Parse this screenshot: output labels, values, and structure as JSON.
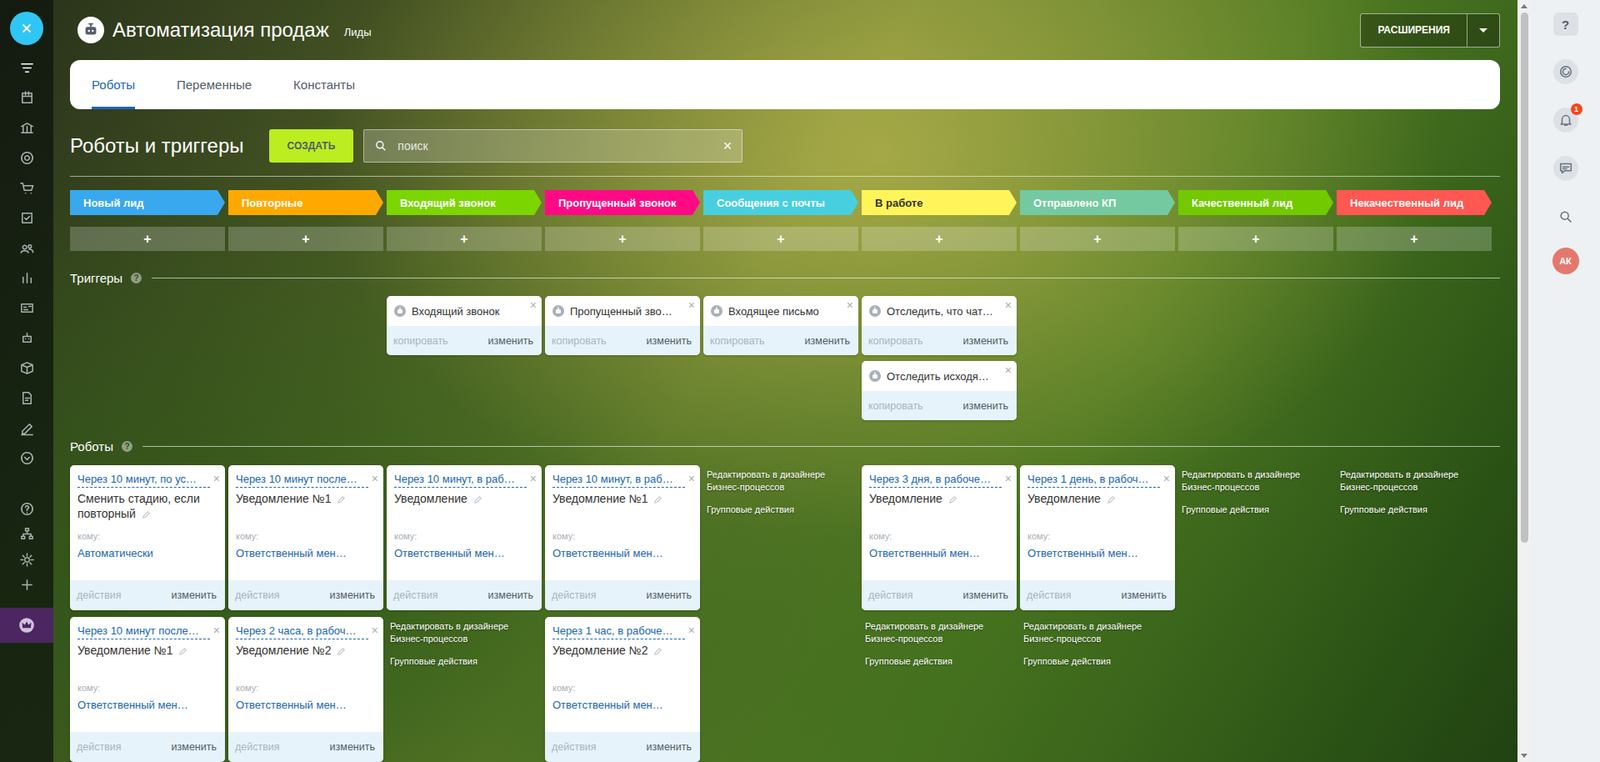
{
  "app": {
    "title": "Автоматизация продаж",
    "subtitle": "Лиды",
    "extensions_button": "РАСШИРЕНИЯ"
  },
  "tabs": [
    {
      "label": "Роботы",
      "selected": true
    },
    {
      "label": "Переменные",
      "selected": false
    },
    {
      "label": "Константы",
      "selected": false
    }
  ],
  "toolbar": {
    "heading": "Роботы и триггеры",
    "create_button": "СОЗДАТЬ",
    "search": {
      "placeholder": "поиск",
      "clear": "×"
    }
  },
  "add_symbol": "+",
  "sections": {
    "triggers": {
      "title": "Триггеры",
      "help": "?"
    },
    "robots": {
      "title": "Роботы",
      "help": "?"
    }
  },
  "labels": {
    "close": "×",
    "copy": {
      "text": "копировать",
      "disabled": true
    },
    "edit": {
      "text": "изменить",
      "disabled": false
    },
    "actions": {
      "text": "действия",
      "disabled": true
    },
    "recipient": "кому:"
  },
  "stages": [
    {
      "name": "Новый лид",
      "color": "#39a8ef",
      "triggers": [],
      "robots": [
        {
          "delay": "Через 10 минут, по ус…",
          "title": "Сменить стадию, если повторный",
          "recipient": "Автоматически"
        },
        {
          "delay": "Через 10 минут после…",
          "title": "Уведомление №1",
          "recipient": "Ответственный мен…"
        }
      ],
      "links": []
    },
    {
      "name": "Повторные",
      "color": "#ffa900",
      "triggers": [],
      "robots": [
        {
          "delay": "Через 10 минут после…",
          "title": "Уведомление №1",
          "recipient": "Ответственный мен…"
        },
        {
          "delay": "Через 2 часа, в рабоч…",
          "title": "Уведомление №2",
          "recipient": "Ответственный мен…"
        }
      ],
      "links": []
    },
    {
      "name": "Входящий звонок",
      "color": "#7bd500",
      "triggers": [
        "Входящий звонок"
      ],
      "robots": [
        {
          "delay": "Через 10 минут, в раб…",
          "title": "Уведомление",
          "recipient": "Ответственный мен…"
        }
      ],
      "links": [
        "Редактировать в дизайнере Бизнес-процессов",
        "Групповые действия"
      ]
    },
    {
      "name": "Пропущенный звонок",
      "color": "#ff0a84",
      "triggers": [
        "Пропущенный зво…"
      ],
      "robots": [
        {
          "delay": "Через 10 минут, в раб…",
          "title": "Уведомление №1",
          "recipient": "Ответственный мен…"
        },
        {
          "delay": "Через 1 час, в рабоче…",
          "title": "Уведомление №2",
          "recipient": "Ответственный мен…"
        }
      ],
      "links": []
    },
    {
      "name": "Сообщения с почты",
      "color": "#47cfe0",
      "triggers": [
        "Входящее письмо"
      ],
      "robots": [],
      "links": [
        "Редактировать в дизайнере Бизнес-процессов",
        "Групповые действия"
      ]
    },
    {
      "name": "В работе",
      "color": "#fff55a",
      "triggers": [
        "Отследить, что чат…",
        "Отследить исходя…"
      ],
      "robots": [
        {
          "delay": "Через 3 дня, в рабоче…",
          "title": "Уведомление",
          "recipient": "Ответственный мен…"
        }
      ],
      "links": [
        "Редактировать в дизайнере Бизнес-процессов",
        "Групповые действия"
      ]
    },
    {
      "name": "Отправлено КП",
      "color": "#74c9a0",
      "triggers": [],
      "robots": [
        {
          "delay": "Через 1 день, в рабоч…",
          "title": "Уведомление",
          "recipient": "Ответственный мен…"
        }
      ],
      "links": [
        "Редактировать в дизайнере Бизнес-процессов",
        "Групповые действия"
      ]
    },
    {
      "name": "Качественный лид",
      "color": "#72c900",
      "triggers": [],
      "robots": [],
      "links": [
        "Редактировать в дизайнере Бизнес-процессов",
        "Групповые действия"
      ]
    },
    {
      "name": "Некачественный лид",
      "color": "#ff5752",
      "triggers": [],
      "robots": [],
      "links": [
        "Редактировать в дизайнере Бизнес-процессов",
        "Групповые действия"
      ]
    }
  ],
  "sidebar": {
    "items": [
      {
        "selected": true
      },
      {
        "selected": false
      },
      {
        "selected": false
      },
      {
        "selected": false
      },
      {
        "selected": false
      },
      {
        "selected": false
      },
      {
        "selected": false
      },
      {
        "selected": false
      },
      {
        "selected": false
      },
      {
        "selected": false
      },
      {
        "selected": false
      },
      {
        "selected": false
      },
      {
        "selected": false
      },
      {
        "selected": false
      }
    ],
    "bottom_items": [
      {
        "selected": false
      },
      {
        "selected": false
      },
      {
        "selected": false
      },
      {
        "selected": false
      }
    ],
    "promo": {
      "highlighted": true
    }
  },
  "right_panel": {
    "help": "?",
    "notifications": "1",
    "avatar": "АК"
  },
  "scrollbar": {
    "level": 0.72
  }
}
